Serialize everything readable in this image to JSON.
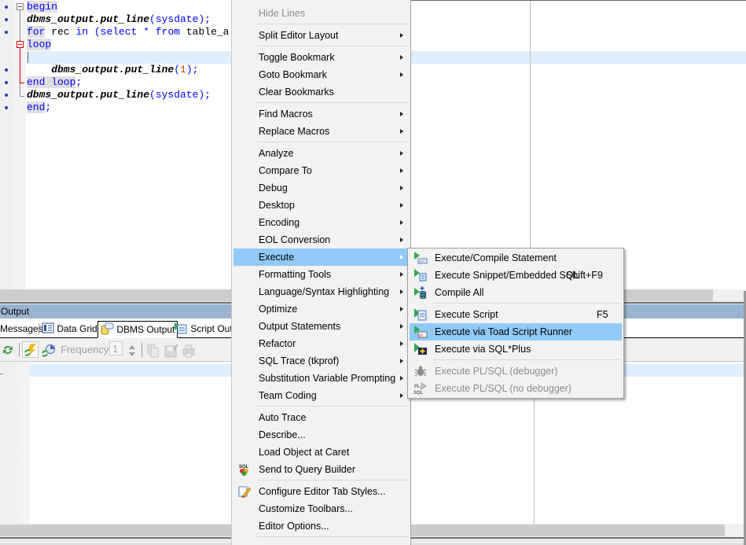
{
  "editor": {
    "lines": [
      {
        "tokens": [
          {
            "t": "begin",
            "c": "kw hl"
          }
        ]
      },
      {
        "tokens": [
          {
            "t": "dbms_output.put_line",
            "c": "fn"
          },
          {
            "t": "(sysdate);",
            "c": "pn"
          }
        ]
      },
      {
        "tokens": [
          {
            "t": "for",
            "c": "kw hl"
          },
          {
            "t": " rec ",
            "c": ""
          },
          {
            "t": "in",
            "c": "kw"
          },
          {
            "t": " (",
            "c": "pn"
          },
          {
            "t": "select",
            "c": "kw"
          },
          {
            "t": " * ",
            "c": "pn"
          },
          {
            "t": "from",
            "c": "kw"
          },
          {
            "t": " table_a",
            "c": ""
          }
        ]
      },
      {
        "tokens": [
          {
            "t": "loop",
            "c": "kw hl"
          }
        ]
      },
      {
        "tokens": []
      },
      {
        "tokens": [
          {
            "t": "    dbms_output.put_line",
            "c": "fn"
          },
          {
            "t": "(",
            "c": "pn"
          },
          {
            "t": "1",
            "c": "num"
          },
          {
            "t": ");",
            "c": "pn"
          }
        ]
      },
      {
        "tokens": [
          {
            "t": "end loop",
            "c": "kw hl"
          },
          {
            "t": ";",
            "c": "pn"
          }
        ]
      },
      {
        "tokens": [
          {
            "t": "dbms_output.put_line",
            "c": "fn"
          },
          {
            "t": "(sysdate);",
            "c": "pn"
          }
        ]
      },
      {
        "tokens": [
          {
            "t": "end",
            "c": "kw hl"
          },
          {
            "t": ";",
            "c": "pn"
          }
        ]
      }
    ]
  },
  "output_panel": {
    "title": "Output",
    "tabs": [
      {
        "label": "Messages",
        "icon": "messages-icon"
      },
      {
        "label": "Data Grid",
        "icon": "data-grid-icon"
      },
      {
        "label": "DBMS Output",
        "icon": "dbms-output-icon",
        "active": true
      },
      {
        "label": "Script Outp",
        "icon": "script-output-icon"
      }
    ],
    "toolbar": {
      "frequency_label": "Frequency:",
      "frequency_value": "1"
    }
  },
  "context_menu": {
    "items": [
      {
        "label": "Hide Lines",
        "disabled": true
      },
      {
        "sep": true
      },
      {
        "label": "Split Editor Layout",
        "submenu": true
      },
      {
        "sep": true
      },
      {
        "label": "Toggle Bookmark",
        "submenu": true
      },
      {
        "label": "Goto Bookmark",
        "submenu": true
      },
      {
        "label": "Clear Bookmarks"
      },
      {
        "sep": true
      },
      {
        "label": "Find Macros",
        "submenu": true
      },
      {
        "label": "Replace Macros",
        "submenu": true
      },
      {
        "sep": true
      },
      {
        "label": "Analyze",
        "submenu": true
      },
      {
        "label": "Compare To",
        "submenu": true
      },
      {
        "label": "Debug",
        "submenu": true
      },
      {
        "label": "Desktop",
        "submenu": true
      },
      {
        "label": "Encoding",
        "submenu": true
      },
      {
        "label": "EOL Conversion",
        "submenu": true
      },
      {
        "label": "Execute",
        "submenu": true,
        "selected": true
      },
      {
        "label": "Formatting Tools",
        "submenu": true
      },
      {
        "label": "Language/Syntax Highlighting",
        "submenu": true
      },
      {
        "label": "Optimize",
        "submenu": true
      },
      {
        "label": "Output Statements",
        "submenu": true
      },
      {
        "label": "Refactor",
        "submenu": true
      },
      {
        "label": "SQL Trace (tkprof)",
        "submenu": true
      },
      {
        "label": "Substitution Variable Prompting",
        "submenu": true
      },
      {
        "label": "Team Coding",
        "submenu": true
      },
      {
        "sep": true
      },
      {
        "label": "Auto Trace"
      },
      {
        "label": "Describe..."
      },
      {
        "label": "Load Object at Caret"
      },
      {
        "label": "Send to Query Builder",
        "icon": "query-builder-icon"
      },
      {
        "sep": true
      },
      {
        "label": "Configure Editor Tab Styles...",
        "icon": "edit-pencil-icon"
      },
      {
        "label": "Customize Toolbars..."
      },
      {
        "label": "Editor Options..."
      },
      {
        "sep": true
      }
    ]
  },
  "execute_submenu": {
    "items": [
      {
        "label": "Execute/Compile Statement",
        "icon": "execute-statement-icon"
      },
      {
        "label": "Execute Snippet/Embedded SQL",
        "shortcut": "Shift+F9",
        "icon": "execute-snippet-icon"
      },
      {
        "label": "Compile All",
        "icon": "compile-all-icon"
      },
      {
        "sep": true
      },
      {
        "label": "Execute Script",
        "shortcut": "F5",
        "icon": "execute-script-icon"
      },
      {
        "label": "Execute via Toad Script Runner",
        "icon": "toad-script-runner-icon",
        "selected": true
      },
      {
        "label": "Execute via SQL*Plus",
        "icon": "sqlplus-icon"
      },
      {
        "sep": true
      },
      {
        "label": "Execute PL/SQL (debugger)",
        "icon": "debugger-bug-icon",
        "disabled": true
      },
      {
        "label": "Execute PL/SQL (no debugger)",
        "icon": "plsql-icon",
        "disabled": true
      }
    ]
  }
}
